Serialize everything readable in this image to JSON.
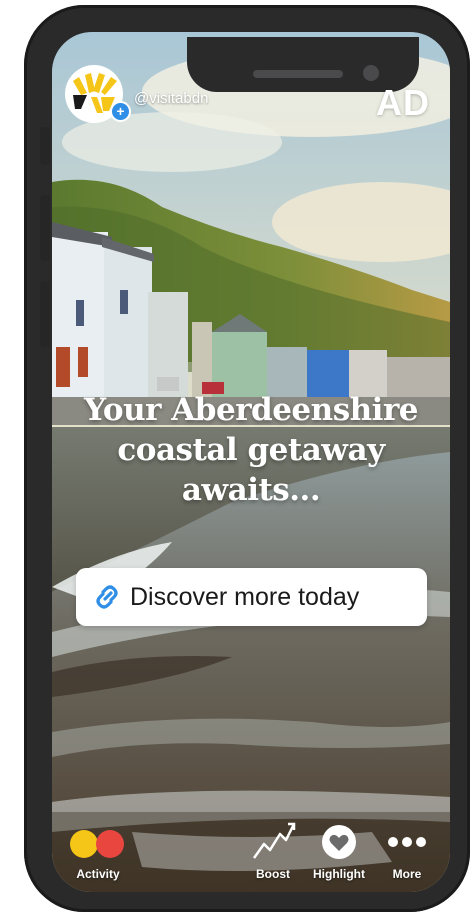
{
  "story": {
    "username": "@visitabdn",
    "ad_label": "AD",
    "headline_lines": [
      "Your Aberdeenshire",
      "coastal getaway",
      "awaits..."
    ],
    "cta_label": "Discover more today",
    "cta_icon": "link-icon"
  },
  "toolbar": {
    "activity_label": "Activity",
    "boost_label": "Boost",
    "highlight_label": "Highlight",
    "more_label": "More"
  },
  "colors": {
    "brand_yellow": "#f5c518",
    "activity_yellow": "#f5c518",
    "activity_red": "#e8463f",
    "link_blue": "#2f8ee6",
    "phone_frame": "#2a2a2b"
  }
}
